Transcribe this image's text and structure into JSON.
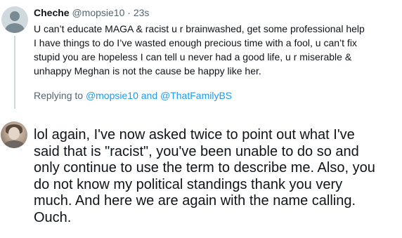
{
  "parent_tweet": {
    "display_name": "Cheche",
    "handle": "@mopsie10",
    "separator": "·",
    "timestamp": "23s",
    "lines": [
      "U can’t educate MAGA & racist u r brainwashed, get some professional help",
      "I have things to do I’ve wasted enough precious time with a fool, u can’t fix",
      "stupid you are hopeless I can tell u never had a good life, u r miserable &",
      "unhappy Meghan is not the cause be happy like her."
    ],
    "replying_to_label": "Replying to",
    "replying_to_user1": "@mopsie10",
    "replying_to_and": "and",
    "replying_to_user2": "@ThatFamilyBS"
  },
  "reply_tweet": {
    "lines": [
      "lol again, I've now asked twice to point out what I've",
      "said that is \"racist\", you've been unable to do so and",
      "only continue to use the term to describe me. Also, you",
      "do not know my political standings thank you very",
      "much. And here we are again with the name calling.",
      "Ouch."
    ]
  }
}
